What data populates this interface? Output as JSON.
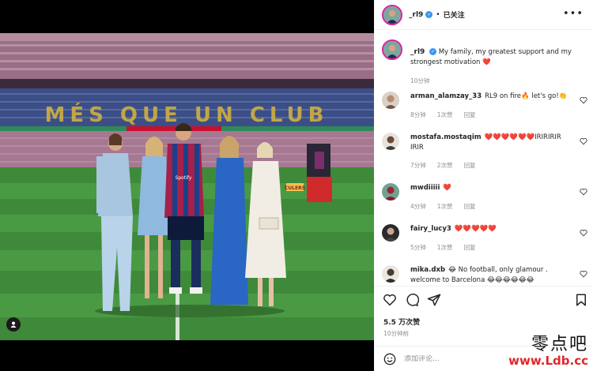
{
  "post": {
    "username": "_rl9",
    "separator": "•",
    "follow_status": "已关注",
    "more": "•••",
    "caption_user": "_rl9",
    "caption_text": "My family, my greatest support and my strongest motivation ❤️",
    "caption_time": "10分钟",
    "likes": "5.5 万次赞",
    "time_ago": "10分钟前",
    "comment_placeholder": "添加评论..."
  },
  "comments": [
    {
      "user": "arman_alamzay_33",
      "text": "RL9 on fire🔥 let's go!👏",
      "time": "8分钟",
      "likes": "1次赞",
      "reply": "回复"
    },
    {
      "user": "mostafa.mostaqim",
      "text": "❤️❤️❤️❤️❤️❤️IRIRIRIR IRIR",
      "time": "7分钟",
      "likes": "2次赞",
      "reply": "回复"
    },
    {
      "user": "mwdiiiii",
      "text": "❤️",
      "time": "4分钟",
      "likes": "1次赞",
      "reply": "回复"
    },
    {
      "user": "fairy_lucy3",
      "text": "❤️❤️❤️❤️❤️",
      "time": "5分钟",
      "likes": "1次赞",
      "reply": "回复"
    },
    {
      "user": "mika.dxb",
      "text": "😂 No football, only glamour . welcome to Barcelona 😂😂😂😂😂😂",
      "time": "",
      "likes": "",
      "reply": ""
    }
  ],
  "photo": {
    "stand_text_1": "MÉS QUE UN CLUB",
    "banner_text": "CULERS",
    "jersey_text": "Spotify"
  },
  "icons": [
    "heart-icon",
    "comment-icon",
    "share-icon",
    "bookmark-icon",
    "emoji-icon",
    "tag-user-icon",
    "more-icon",
    "verified-icon"
  ],
  "colors": {
    "verified": "#3897f0",
    "like_red": "#ed4956",
    "story_ring": "#d6249f",
    "muted_text": "#8e8e8e"
  },
  "watermark": {
    "cn": "零点吧",
    "url": "www.Ldb.cc"
  }
}
